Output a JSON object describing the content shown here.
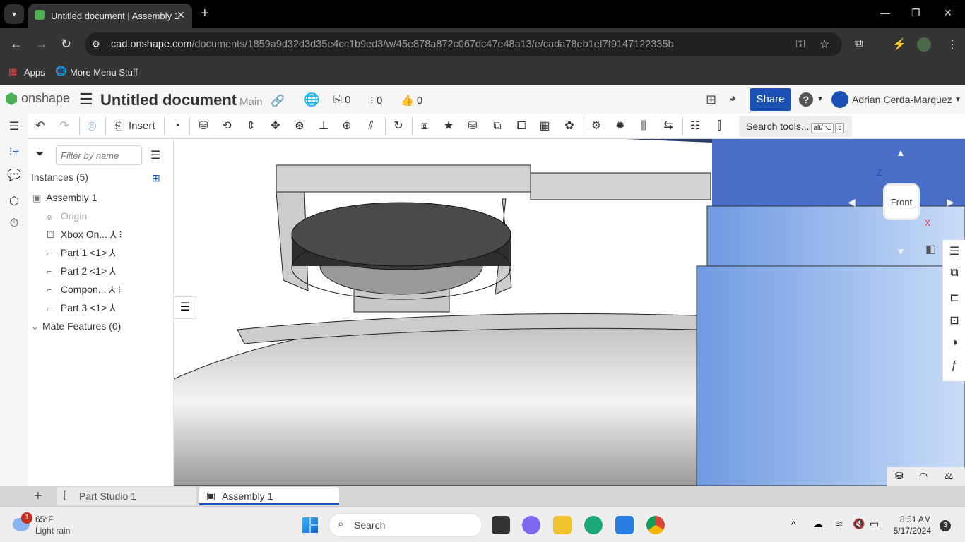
{
  "browser": {
    "tab_title": "Untitled document | Assembly 1",
    "url_host": "cad.onshape.com",
    "url_path": "/documents/1859a9d32d3d35e4cc1b9ed3/w/45e878a872c067dc47e48a13/e/cada78eb1ef7f9147122335b",
    "bookmarks": [
      "Apps",
      "More Menu Stuff"
    ]
  },
  "header": {
    "logo": "onshape",
    "title": "Untitled document",
    "branch": "Main",
    "versions_count": "0",
    "branches_count": "0",
    "likes_count": "0",
    "share_label": "Share",
    "user_name": "Adrian Cerda-Marquez"
  },
  "toolbar": {
    "insert_label": "Insert",
    "search_label": "Search tools...",
    "search_kbd1": "alt/⌥",
    "search_kbd2": "c"
  },
  "panel": {
    "filter_placeholder": "Filter by name",
    "instances_header": "Instances (5)",
    "items": [
      {
        "label": "Assembly 1",
        "icon": "assembly-icon"
      },
      {
        "label": "Origin",
        "icon": "origin-icon"
      },
      {
        "label": "Xbox On...",
        "icon": "subassembly-icon"
      },
      {
        "label": "Part 1 <1>",
        "icon": "part-icon"
      },
      {
        "label": "Part 2 <1>",
        "icon": "part-icon"
      },
      {
        "label": "Compon...",
        "icon": "part-icon"
      },
      {
        "label": "Part 3 <1>",
        "icon": "part-icon"
      }
    ],
    "mate_features": "Mate Features (0)"
  },
  "viewcube": {
    "face": "Front",
    "axis_z": "Z",
    "axis_x": "X"
  },
  "tabs": [
    {
      "label": "Part Studio 1",
      "active": false
    },
    {
      "label": "Assembly 1",
      "active": true
    }
  ],
  "taskbar": {
    "temp": "65°F",
    "weather": "Light rain",
    "weather_badge": "1",
    "search": "Search",
    "time": "8:51 AM",
    "date": "5/17/2024",
    "notif_count": "3"
  },
  "colors": {
    "accent": "#1a52b5",
    "onshape_green": "#4caf50",
    "model_blue": "#4a6fc9"
  }
}
